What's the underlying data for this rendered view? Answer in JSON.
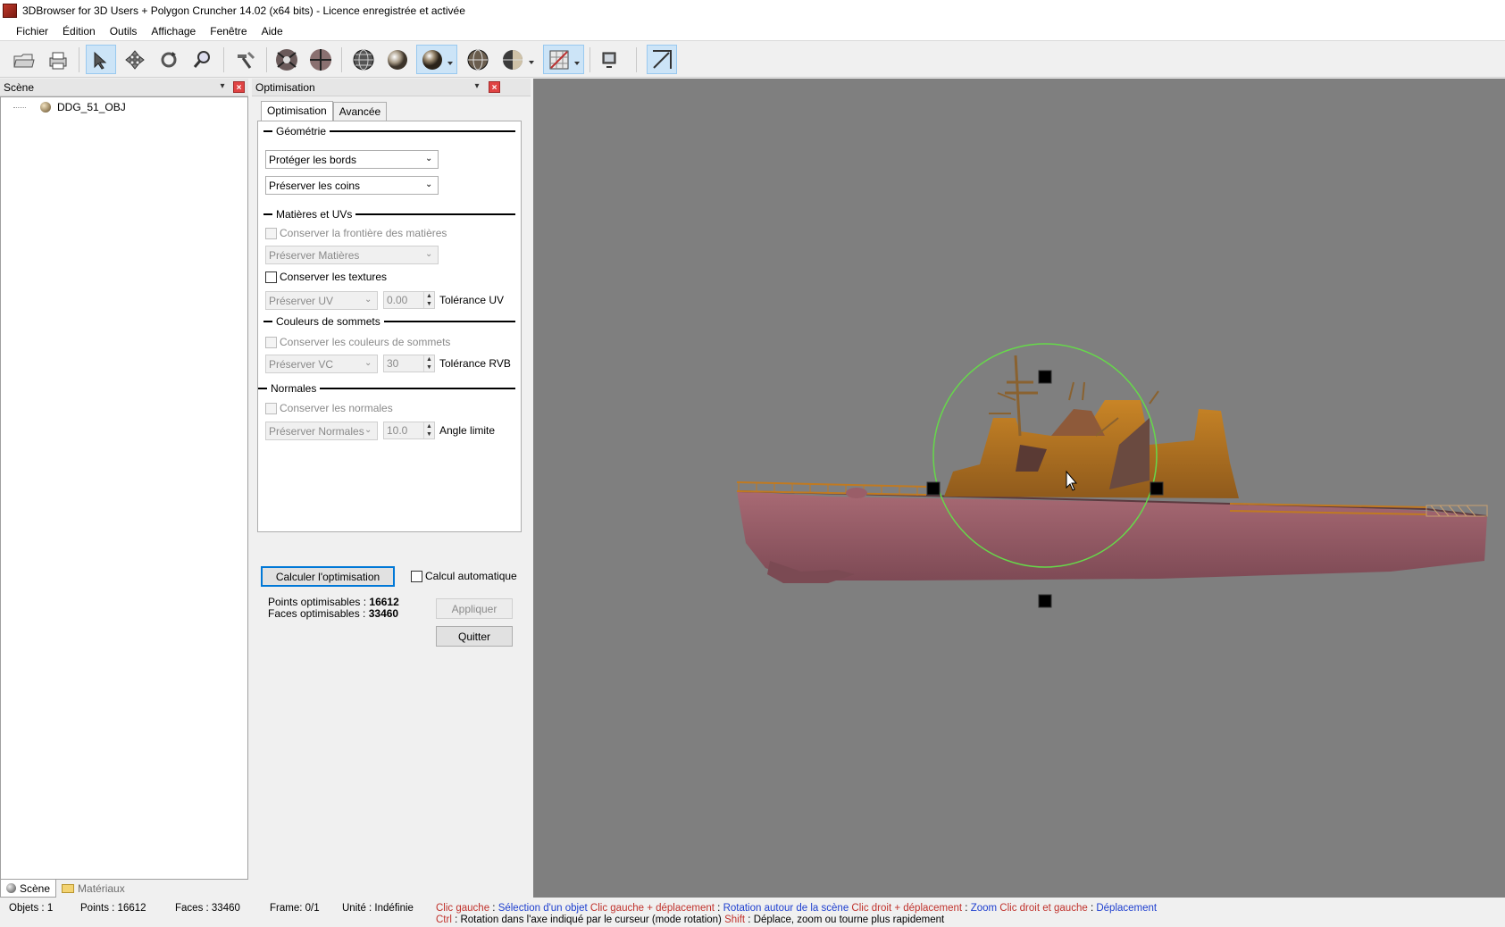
{
  "window": {
    "title": "3DBrowser for 3D Users + Polygon Cruncher 14.02 (x64 bits) - Licence enregistrée et activée"
  },
  "menu": [
    "Fichier",
    "Édition",
    "Outils",
    "Affichage",
    "Fenêtre",
    "Aide"
  ],
  "toolbar": {
    "buttons": [
      "open-file",
      "print",
      "select",
      "move",
      "rotate",
      "zoom",
      "tools",
      "view-mode",
      "target",
      "wireframe-sphere",
      "flat-sphere",
      "smooth-sphere",
      "textured-sphere",
      "half-sphere",
      "texture-map",
      "display",
      "resize"
    ]
  },
  "scene_panel": {
    "title": "Scène",
    "tree": [
      {
        "label": "DDG_51_OBJ"
      }
    ],
    "tabs": {
      "scene": "Scène",
      "materials": "Matériaux"
    }
  },
  "opt_panel": {
    "title": "Optimisation",
    "tabs": {
      "optimisation": "Optimisation",
      "avancee": "Avancée"
    },
    "geometry": {
      "title": "Géométrie",
      "edges": "Protéger les bords",
      "corners": "Préserver les coins"
    },
    "materials": {
      "title": "Matières et UVs",
      "keep_boundary": "Conserver la frontière des matières",
      "preserve_materials": "Préserver Matières",
      "keep_textures": "Conserver les textures",
      "preserve_uv": "Préserver UV",
      "uv_value": "0.00",
      "uv_label": "Tolérance UV"
    },
    "vertex_colors": {
      "title": "Couleurs de sommets",
      "keep": "Conserver les couleurs de sommets",
      "preserve": "Préserver VC",
      "value": "30",
      "label": "Tolérance RVB"
    },
    "normals": {
      "title": "Normales",
      "keep": "Conserver les normales",
      "preserve": "Préserver Normales",
      "value": "10.0",
      "label": "Angle limite"
    },
    "compute_button": "Calculer l'optimisation",
    "auto_compute": "Calcul automatique",
    "points_label": "Points optimisables :",
    "points_value": "16612",
    "faces_label": "Faces optimisables :",
    "faces_value": "33460",
    "apply_button": "Appliquer",
    "quit_button": "Quitter"
  },
  "status": {
    "objects": "Objets : 1",
    "points": "Points : 16612",
    "faces": "Faces : 33460",
    "frame": "Frame: 0/1",
    "unit": "Unité : Indéfinie",
    "help_line1": [
      {
        "text": "Clic gauche",
        "color": "red"
      },
      {
        "text": " : ",
        "color": "black"
      },
      {
        "text": "Sélection d'un objet",
        "color": "blue"
      },
      {
        "text": " Clic gauche + déplacement",
        "color": "red"
      },
      {
        "text": " : ",
        "color": "black"
      },
      {
        "text": "Rotation autour de la scène",
        "color": "blue"
      },
      {
        "text": " Clic droit + déplacement",
        "color": "red"
      },
      {
        "text": " : ",
        "color": "black"
      },
      {
        "text": "Zoom",
        "color": "blue"
      },
      {
        "text": " Clic droit et gauche",
        "color": "red"
      },
      {
        "text": " : ",
        "color": "black"
      },
      {
        "text": "Déplacement",
        "color": "blue"
      }
    ],
    "help_line2": [
      {
        "text": "Ctrl",
        "color": "red"
      },
      {
        "text": " : Rotation dans l'axe indiqué par le curseur (mode rotation) ",
        "color": "black"
      },
      {
        "text": "Shift",
        "color": "red"
      },
      {
        "text": " : Déplace, zoom ou tourne plus rapidement",
        "color": "black"
      }
    ]
  },
  "colors": {
    "viewport_bg": "#7f7f7f",
    "hull": "#9a5e68",
    "superstructure": "#b5701a",
    "gizmo": "#66d94a",
    "accent": "#0078d7"
  }
}
